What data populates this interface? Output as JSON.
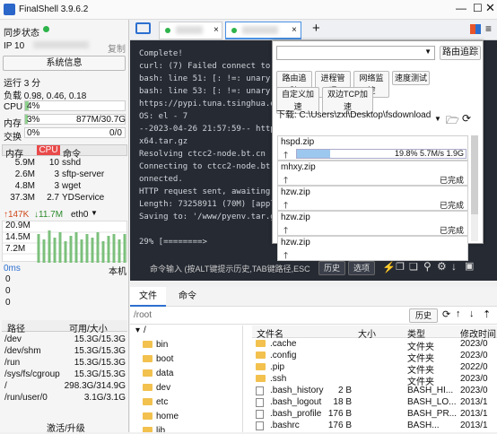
{
  "app": {
    "title": "FinalShell 3.9.6.2"
  },
  "sidebar": {
    "sync": "同步状态",
    "ip_label": "IP 10",
    "copy": "复制",
    "sysinfo": "系统信息",
    "uptime": "运行 3 分",
    "load": "负载 0.98, 0.46, 0.18",
    "cpu_label": "CPU",
    "cpu_val": "4%",
    "mem_label": "内存",
    "mem_pct": "3%",
    "mem_val": "877M/30.7G",
    "swap_label": "交换",
    "swap_pct": "0%",
    "swap_val": "0/0",
    "proc_headers": [
      "内存",
      "CPU",
      "命令"
    ],
    "procs": [
      {
        "mem": "5.9M",
        "cpu": "10",
        "cmd": "sshd"
      },
      {
        "mem": "2.6M",
        "cpu": "3",
        "cmd": "sftp-server"
      },
      {
        "mem": "4.8M",
        "cpu": "3",
        "cmd": "wget"
      },
      {
        "mem": "37.3M",
        "cpu": "2.7",
        "cmd": "YDService"
      }
    ],
    "net_up": "↑147K",
    "net_down": "↓11.7M",
    "net_if": "eth0",
    "net_scale": [
      "20.9M",
      "14.5M",
      "7.2M"
    ],
    "ping_label": "0ms",
    "ping_host": "本机",
    "ping_vals": [
      "0",
      "0",
      "0"
    ],
    "disk_headers": [
      "路径",
      "可用/大小"
    ],
    "disks": [
      {
        "p": "/dev",
        "s": "15.3G/15.3G"
      },
      {
        "p": "/dev/shm",
        "s": "15.3G/15.3G"
      },
      {
        "p": "/run",
        "s": "15.3G/15.3G"
      },
      {
        "p": "/sys/fs/cgroup",
        "s": "15.3G/15.3G"
      },
      {
        "p": "/",
        "s": "298.3G/314.9G"
      },
      {
        "p": "/run/user/0",
        "s": "3.1G/3.1G"
      }
    ],
    "activate": "激活/升级"
  },
  "tabs": [
    {
      "label": "1"
    },
    {
      "label": "2"
    }
  ],
  "terminal": {
    "lines": [
      "Complete!",
      "curl: (7) Failed connect to p",
      "bash: line 51: [: !=: unary o",
      "bash: line 53: [: !=: unary o",
      "https://pypi.tuna.tsinghua.ed",
      "OS: el - 7",
      "--2023-04-26 21:57:59--  http",
      "x64.tar.gz",
      "Resolving ctcc2-node.bt.cn (c",
      "Connecting to ctcc2-node.bt.cn",
      "onnected.",
      "HTTP request sent, awaiting r",
      "Length: 73258911 (70M) [appl",
      "Saving to: '/www/pyenv.tar.gz",
      "",
      "29% [========>"
    ],
    "cmd_placeholder": "命令输入 (按ALT键提示历史,TAB键路径,ESC",
    "history_btn": "历史",
    "select_btn": "选项"
  },
  "popup": {
    "route_btn": "路由追踪",
    "btns": [
      "路由追踪",
      "进程管理",
      "网络监控",
      "速度测试",
      "自定义加速",
      "双边TCP加速"
    ],
    "download_label": "下载: C:\\Users\\zxl\\Desktop\\fsdownload",
    "downloads": [
      {
        "name": "hspd.zip",
        "status": "19.8% 5.7M/s 1.9G",
        "progress": 0.198
      },
      {
        "name": "mhxy.zip",
        "status": "已完成"
      },
      {
        "name": "hzw.zip",
        "status": "已完成"
      },
      {
        "name": "hzw.zip",
        "status": "已完成"
      },
      {
        "name": "hzw.zip",
        "status": ""
      }
    ]
  },
  "files": {
    "tab_files": "文件",
    "tab_cmd": "命令",
    "path": "/root",
    "history": "历史",
    "tree": [
      "/",
      "bin",
      "boot",
      "data",
      "dev",
      "etc",
      "home",
      "lib"
    ],
    "headers": [
      "文件名",
      "大小",
      "类型",
      "修改时间"
    ],
    "rows": [
      {
        "n": ".cache",
        "s": "",
        "t": "文件夹",
        "d": "2023/0",
        "dir": true
      },
      {
        "n": ".config",
        "s": "",
        "t": "文件夹",
        "d": "2023/0",
        "dir": true
      },
      {
        "n": ".pip",
        "s": "",
        "t": "文件夹",
        "d": "2022/0",
        "dir": true
      },
      {
        "n": ".ssh",
        "s": "",
        "t": "文件夹",
        "d": "2023/0",
        "dir": true
      },
      {
        "n": ".bash_history",
        "s": "2 B",
        "t": "BASH_HI...",
        "d": "2023/0",
        "dir": false
      },
      {
        "n": ".bash_logout",
        "s": "18 B",
        "t": "BASH_LO...",
        "d": "2013/1",
        "dir": false
      },
      {
        "n": ".bash_profile",
        "s": "176 B",
        "t": "BASH_PR...",
        "d": "2013/1",
        "dir": false
      },
      {
        "n": ".bashrc",
        "s": "176 B",
        "t": "BASH...",
        "d": "2013/1",
        "dir": false
      }
    ]
  }
}
